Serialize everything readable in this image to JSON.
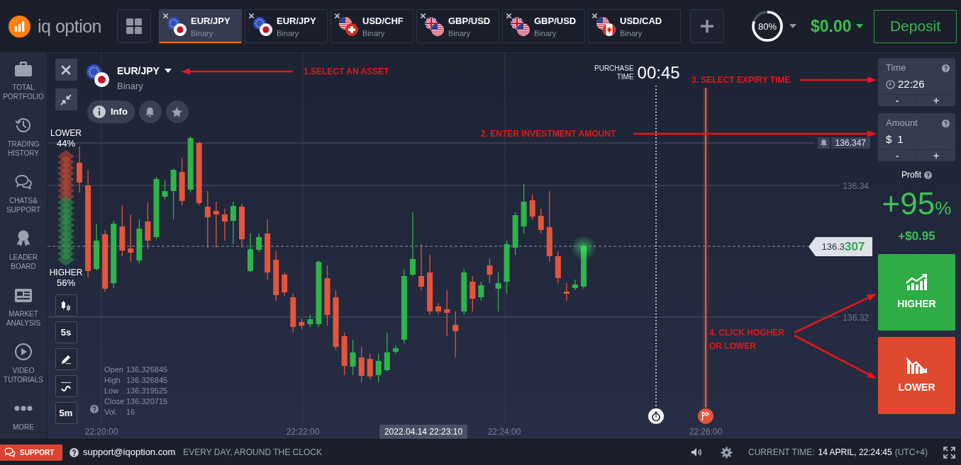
{
  "header": {
    "logo": "iq option",
    "tabs": [
      {
        "symbol": "EUR/JPY",
        "type": "Binary",
        "selected": true,
        "flags": [
          {
            "kind": "eu"
          },
          {
            "kind": "jp"
          }
        ]
      },
      {
        "symbol": "EUR/JPY",
        "type": "Binary",
        "selected": false,
        "flags": [
          {
            "kind": "eu"
          },
          {
            "kind": "jp"
          }
        ]
      },
      {
        "symbol": "USD/CHF",
        "type": "Binary",
        "selected": false,
        "flags": [
          {
            "kind": "us"
          },
          {
            "kind": "ch"
          }
        ]
      },
      {
        "symbol": "GBP/USD",
        "type": "Binary",
        "selected": false,
        "flags": [
          {
            "kind": "gb"
          },
          {
            "kind": "us"
          }
        ]
      },
      {
        "symbol": "GBP/USD",
        "type": "Binary",
        "selected": false,
        "flags": [
          {
            "kind": "gb"
          },
          {
            "kind": "us"
          }
        ]
      },
      {
        "symbol": "USD/CAD",
        "type": "Binary",
        "selected": false,
        "flags": [
          {
            "kind": "us"
          },
          {
            "kind": "ca"
          }
        ]
      }
    ],
    "progress": {
      "label": "80%",
      "level": 0.8
    },
    "balance": "$0.00",
    "deposit": "Deposit"
  },
  "sidebar": {
    "items": [
      {
        "kind": "portfolio",
        "label": "TOTAL PORTFOLIO"
      },
      {
        "kind": "history",
        "label": "TRADING HISTORY"
      },
      {
        "kind": "chat",
        "label": "CHATS& SUPPORT"
      },
      {
        "kind": "leaders",
        "label": "LEADER BOARD"
      },
      {
        "kind": "analysis",
        "label": "MARKET ANALYSIS"
      },
      {
        "kind": "video",
        "label": "VIDEO TUTORIALS"
      },
      {
        "kind": "more",
        "label": "MORE"
      }
    ]
  },
  "chart": {
    "asset": {
      "symbol": "EUR/JPY",
      "type": "Binary",
      "flags": [
        {
          "kind": "eu"
        },
        {
          "kind": "jp"
        }
      ]
    },
    "actions": [
      {
        "kind": "info",
        "label": "Info"
      },
      {
        "kind": "bell"
      },
      {
        "kind": "star"
      }
    ],
    "sentiment": {
      "lower_label": "LOWER",
      "lower_percent": "44%",
      "higher_label": "HIGHER",
      "higher_percent": "56%",
      "level": 0.44
    },
    "tools": [
      {
        "kind": "candles"
      },
      {
        "kind": "label",
        "label": "5s"
      },
      {
        "kind": "pencil"
      },
      {
        "kind": "indicator"
      },
      {
        "kind": "label",
        "label": "5m"
      }
    ],
    "ohlc": [
      {
        "label": "Open",
        "value": "136.326845"
      },
      {
        "label": "High",
        "value": "136.326845"
      },
      {
        "label": "Low",
        "value": "136.319525"
      },
      {
        "label": "Close",
        "value": "136.320715"
      },
      {
        "label": "Vol.",
        "value": "16"
      }
    ],
    "purchase_time": {
      "label": "PURCHASE TIME",
      "value": "00:45"
    },
    "alert_price": "136.347",
    "price_levels": [
      "136.34",
      "136.32"
    ],
    "current_price": "136.3**307**",
    "time_axis": [
      "22:20:00",
      "22:22:00",
      "22:24:00",
      "22:26:00"
    ],
    "cursor_time": "2022.04.14 22:23:10"
  },
  "trade": {
    "time": {
      "label": "Time",
      "value": "22:26",
      "decrease": "-",
      "increase": "+"
    },
    "amount": {
      "label": "Amount",
      "currency": "$",
      "value": "1",
      "decrease": "-",
      "increase": "+"
    },
    "profit": {
      "label": "Profit",
      "value": "+95",
      "unit": "%",
      "payout": "+$0.95"
    },
    "buttons": [
      {
        "kind": "higher",
        "label": "HIGHER"
      },
      {
        "kind": "lower",
        "label": "LOWER"
      }
    ]
  },
  "footer": {
    "support": "SUPPORT",
    "email": "support@iqoption.com",
    "hours": "EVERY DAY, AROUND THE CLOCK",
    "clock_label": "CURRENT TIME:",
    "clock_value": "14 APRIL, 22:24:45",
    "timezone": "(UTC+4)"
  },
  "annotations": [
    {
      "text": "1.SELECT AN ASSET"
    },
    {
      "text": "2. ENTER INVESTMENT AMOUNT"
    },
    {
      "text": "3. SELECT EXPIRY TIME"
    },
    {
      "text": "4. CLICK HOGHER OR LOWER"
    }
  ]
}
